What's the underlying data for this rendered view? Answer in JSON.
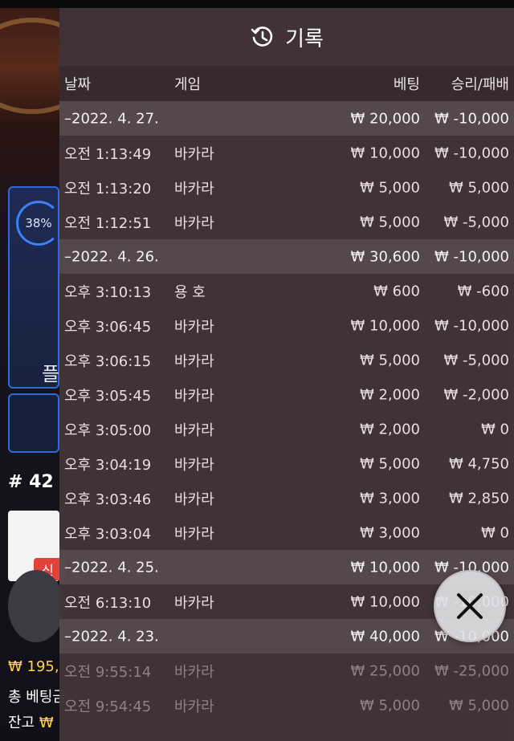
{
  "background": {
    "progress": "38%",
    "partial_button": "플",
    "table_number": "# 42",
    "new_badge": "신",
    "balance": "₩ 195,",
    "total_bet": "총 베팅금",
    "remain_label": "잔고",
    "remain_currency": "₩"
  },
  "history": {
    "title": "기록",
    "icon": "history-icon",
    "columns": {
      "date": "날짜",
      "game": "게임",
      "bet": "베팅",
      "result": "승리/패배"
    },
    "groups": [
      {
        "date": "–2022. 4. 27.",
        "bet": "₩ 20,000",
        "result": "₩ -10,000",
        "rows": [
          {
            "time": "오전 1:13:49",
            "game": "바카라",
            "bet": "₩ 10,000",
            "result": "₩ -10,000"
          },
          {
            "time": "오전 1:13:20",
            "game": "바카라",
            "bet": "₩ 5,000",
            "result": "₩ 5,000"
          },
          {
            "time": "오전 1:12:51",
            "game": "바카라",
            "bet": "₩ 5,000",
            "result": "₩ -5,000"
          }
        ]
      },
      {
        "date": "–2022. 4. 26.",
        "bet": "₩ 30,600",
        "result": "₩ -10,000",
        "rows": [
          {
            "time": "오후 3:10:13",
            "game": "용 호",
            "bet": "₩ 600",
            "result": "₩ -600"
          },
          {
            "time": "오후 3:06:45",
            "game": "바카라",
            "bet": "₩ 10,000",
            "result": "₩ -10,000"
          },
          {
            "time": "오후 3:06:15",
            "game": "바카라",
            "bet": "₩ 5,000",
            "result": "₩ -5,000"
          },
          {
            "time": "오후 3:05:45",
            "game": "바카라",
            "bet": "₩ 2,000",
            "result": "₩ -2,000"
          },
          {
            "time": "오후 3:05:00",
            "game": "바카라",
            "bet": "₩ 2,000",
            "result": "₩ 0"
          },
          {
            "time": "오후 3:04:19",
            "game": "바카라",
            "bet": "₩ 5,000",
            "result": "₩ 4,750"
          },
          {
            "time": "오후 3:03:46",
            "game": "바카라",
            "bet": "₩ 3,000",
            "result": "₩ 2,850"
          },
          {
            "time": "오후 3:03:04",
            "game": "바카라",
            "bet": "₩ 3,000",
            "result": "₩ 0"
          }
        ]
      },
      {
        "date": "–2022. 4. 25.",
        "bet": "₩ 10,000",
        "result": "₩ -10,000",
        "rows": [
          {
            "time": "오전 6:13:10",
            "game": "바카라",
            "bet": "₩ 10,000",
            "result": "₩ -10,000"
          }
        ]
      },
      {
        "date": "–2022. 4. 23.",
        "bet": "₩ 40,000",
        "result": "₩ -10,000",
        "rows": [
          {
            "time": "오전 9:55:14",
            "game": "바카라",
            "bet": "₩ 25,000",
            "result": "₩ -25,000",
            "faded": true
          },
          {
            "time": "오전 9:54:45",
            "game": "바카라",
            "bet": "₩ 5,000",
            "result": "₩ 5,000",
            "faded": true
          }
        ]
      }
    ],
    "close_icon": "close-icon"
  }
}
